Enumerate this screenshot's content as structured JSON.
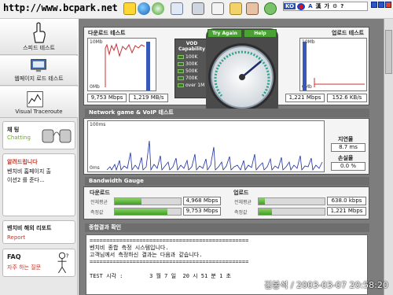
{
  "toolbar": {
    "title": "http://www.bcpark.net",
    "ime": [
      "KO",
      "A",
      "漢",
      "가",
      "⚙",
      "?"
    ]
  },
  "sidebar": {
    "speed_test": "스피드 테스트",
    "webpage_test": "웹페이지 로드 테스트",
    "traceroute": "Visual Traceroute",
    "chat_title": "채 팅",
    "chat_sub": "Chatting",
    "notice_title": "알려드립니다",
    "notice_line1": "벤치비 홈페이지 출",
    "notice_line2": "이션2 를 준다...",
    "report_title": "벤치비 해외 리포트",
    "report_sub": "Report",
    "faq_title": "FAQ",
    "faq_sub": "자주 하는 질문"
  },
  "download_test": {
    "title": "다운로드 테스트",
    "scale_top": "10Mb",
    "scale_bottom": "0Mb",
    "mbps": "9,753 Mbps",
    "mbs": "1,219 MB/s"
  },
  "upload_test": {
    "title": "업로드 테스트",
    "scale_top": "10Mb",
    "scale_bottom": "0Mb",
    "mbps": "1,221 Mbps",
    "kbs": "152.6 KB/s"
  },
  "gauge": {
    "try_again": "Try Again",
    "help": "Help",
    "capability_title": "VOD Capability",
    "levels": [
      "100K",
      "300K",
      "500K",
      "700K",
      "over 1M"
    ]
  },
  "voip": {
    "title": "Network game & VoIP 테스트",
    "scale_top": "100ms",
    "scale_bottom": "0ms",
    "latency_label": "지연율",
    "latency_value": "8.7 ms",
    "loss_label": "손실율",
    "loss_value": "0.0 %"
  },
  "bandwidth": {
    "title": "Bandwidth Gauge",
    "download_label": "다운로드",
    "upload_label": "업로드",
    "overall_label": "전체평균",
    "measured_label": "측정값",
    "dl_overall": "4,968 Mbps",
    "dl_measured": "9,753 Mbps",
    "ul_overall": "638.0 kbps",
    "ul_measured": "1,221 Mbps",
    "dl_overall_fill": 0.4,
    "dl_measured_fill": 0.8,
    "ul_overall_fill": 0.1,
    "ul_measured_fill": 0.2
  },
  "result": {
    "title": "종합결과 확인",
    "line1": "================================================",
    "line2": "벤치비 종합 측정 시스템입니다.",
    "line3": "고객님께서 측정하신 결과는 다음과 같습니다.",
    "line4": "================================================",
    "line5": "TEST 시각 :        3 월 7 일  20 시 51 분 1 초"
  },
  "watermark": "김봉석 / 2003-03-07 20:58:20"
}
